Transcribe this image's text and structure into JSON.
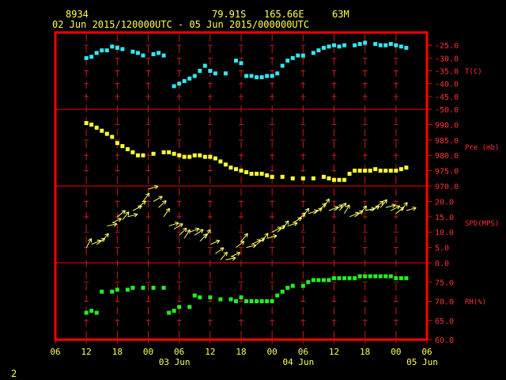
{
  "header": {
    "station_id": "8934",
    "latitude": "79.91S",
    "longitude": "165.66E",
    "elevation": "63M",
    "time_range": "02 Jun 2015/120000UTC - 05 Jun 2015/000000UTC"
  },
  "footer": {
    "page_number": "2"
  },
  "colors": {
    "frame": "#ff0000",
    "grid": "#c81a1a",
    "axis_text": "#ff3030",
    "header_text": "#ffff4f",
    "temperature": "#33e6f0",
    "pressure": "#ffff33",
    "wind": "#ffff66",
    "humidity": "#22ee22"
  },
  "chart_data": {
    "type": "scatter",
    "x_unit": "hours since 02 Jun 2015 12:00 UTC (3-hour ticks)",
    "x": {
      "range": [
        -6,
        66
      ],
      "tick_labels": [
        "06",
        "12",
        "18",
        "00",
        "06",
        "12",
        "18",
        "00",
        "06",
        "12",
        "18",
        "00",
        "06"
      ],
      "day_labels": [
        "03 Jun",
        "04 Jun",
        "05 Jun"
      ]
    },
    "panels": [
      {
        "name": "temperature",
        "label": "T(C)",
        "ylim": [
          -50,
          -20
        ],
        "ticks": [
          -25,
          -30,
          -35,
          -40,
          -45,
          -50
        ],
        "tick_labels": [
          "-25.0",
          "-30.0",
          "-35.0",
          "-40.0",
          "-45.0",
          "-50.0"
        ],
        "points": [
          [
            0,
            -30
          ],
          [
            1,
            -29.5
          ],
          [
            2,
            -28
          ],
          [
            3,
            -27
          ],
          [
            4,
            -27
          ],
          [
            5,
            -25.5
          ],
          [
            6,
            -26
          ],
          [
            7,
            -26.5
          ],
          [
            9,
            -27.5
          ],
          [
            10,
            -28
          ],
          [
            11,
            -29
          ],
          [
            13,
            -28.5
          ],
          [
            14,
            -28
          ],
          [
            15,
            -29
          ],
          [
            17,
            -41
          ],
          [
            18,
            -40
          ],
          [
            19,
            -39
          ],
          [
            20,
            -38
          ],
          [
            21,
            -37
          ],
          [
            22,
            -35
          ],
          [
            23,
            -33
          ],
          [
            24,
            -35
          ],
          [
            25,
            -36
          ],
          [
            27,
            -36
          ],
          [
            29,
            -31
          ],
          [
            30,
            -32
          ],
          [
            31,
            -37
          ],
          [
            32,
            -37
          ],
          [
            33,
            -37.5
          ],
          [
            34,
            -37.5
          ],
          [
            35,
            -37
          ],
          [
            36,
            -37
          ],
          [
            37,
            -36
          ],
          [
            38,
            -33
          ],
          [
            39,
            -31
          ],
          [
            40,
            -30
          ],
          [
            41,
            -29
          ],
          [
            42,
            -29
          ],
          [
            44,
            -28
          ],
          [
            45,
            -27
          ],
          [
            46,
            -26
          ],
          [
            47,
            -25.5
          ],
          [
            48,
            -25
          ],
          [
            49,
            -25.5
          ],
          [
            50,
            -25
          ],
          [
            52,
            -25
          ],
          [
            53,
            -24.5
          ],
          [
            54,
            -24
          ],
          [
            56,
            -24.5
          ],
          [
            57,
            -25
          ],
          [
            58,
            -25
          ],
          [
            59,
            -24.5
          ],
          [
            60,
            -25
          ],
          [
            61,
            -25.5
          ],
          [
            62,
            -26
          ]
        ]
      },
      {
        "name": "pressure",
        "label": "Pre (mb)",
        "ylim": [
          970,
          995
        ],
        "ticks": [
          990,
          985,
          980,
          975,
          970
        ],
        "tick_labels": [
          "990.0",
          "985.0",
          "980.0",
          "975.0",
          "970.0"
        ],
        "points": [
          [
            0,
            990.5
          ],
          [
            1,
            990
          ],
          [
            2,
            989
          ],
          [
            3,
            988
          ],
          [
            4,
            987
          ],
          [
            5,
            986
          ],
          [
            6,
            984
          ],
          [
            7,
            983
          ],
          [
            8,
            982
          ],
          [
            9,
            981
          ],
          [
            10,
            980
          ],
          [
            11,
            980
          ],
          [
            13,
            980.5
          ],
          [
            15,
            981
          ],
          [
            16,
            981
          ],
          [
            17,
            980.5
          ],
          [
            18,
            980
          ],
          [
            19,
            979.5
          ],
          [
            20,
            979.5
          ],
          [
            21,
            980
          ],
          [
            22,
            980
          ],
          [
            23,
            979.5
          ],
          [
            24,
            979.5
          ],
          [
            25,
            979
          ],
          [
            26,
            978
          ],
          [
            27,
            977
          ],
          [
            28,
            976
          ],
          [
            29,
            975.5
          ],
          [
            30,
            975
          ],
          [
            31,
            974.5
          ],
          [
            32,
            974
          ],
          [
            33,
            974
          ],
          [
            34,
            974
          ],
          [
            35,
            973.5
          ],
          [
            36,
            973
          ],
          [
            38,
            973
          ],
          [
            40,
            972.5
          ],
          [
            42,
            972.5
          ],
          [
            44,
            972.5
          ],
          [
            46,
            973
          ],
          [
            47,
            972.5
          ],
          [
            48,
            972
          ],
          [
            49,
            972
          ],
          [
            50,
            972
          ],
          [
            51,
            974
          ],
          [
            52,
            975
          ],
          [
            53,
            975
          ],
          [
            54,
            975
          ],
          [
            55,
            975
          ],
          [
            56,
            975.5
          ],
          [
            57,
            975
          ],
          [
            58,
            975
          ],
          [
            59,
            975
          ],
          [
            60,
            975
          ],
          [
            61,
            975.5
          ],
          [
            62,
            976
          ]
        ]
      },
      {
        "name": "wind_speed",
        "label": "SPD(MPS)",
        "ylim": [
          0,
          25
        ],
        "ticks": [
          20,
          15,
          10,
          5,
          0
        ],
        "tick_labels": [
          "20.0",
          "15.0",
          "10.0",
          "5.0",
          "0.0"
        ],
        "points": [
          [
            0,
            5
          ],
          [
            1,
            6
          ],
          [
            2,
            6
          ],
          [
            3,
            7
          ],
          [
            4,
            12
          ],
          [
            5,
            13
          ],
          [
            6,
            15
          ],
          [
            7,
            14
          ],
          [
            8,
            15
          ],
          [
            9,
            17
          ],
          [
            10,
            18
          ],
          [
            11,
            20
          ],
          [
            12,
            24
          ],
          [
            13,
            20
          ],
          [
            14,
            18
          ],
          [
            15,
            15
          ],
          [
            16,
            12
          ],
          [
            17,
            11
          ],
          [
            18,
            9
          ],
          [
            19,
            8
          ],
          [
            20,
            10
          ],
          [
            21,
            9
          ],
          [
            22,
            7
          ],
          [
            23,
            8
          ],
          [
            24,
            6
          ],
          [
            25,
            3
          ],
          [
            26,
            1
          ],
          [
            27,
            1
          ],
          [
            28,
            2
          ],
          [
            29,
            5
          ],
          [
            30,
            7
          ],
          [
            31,
            5
          ],
          [
            32,
            6
          ],
          [
            33,
            6
          ],
          [
            34,
            7
          ],
          [
            35,
            8
          ],
          [
            36,
            10
          ],
          [
            37,
            10
          ],
          [
            38,
            11
          ],
          [
            39,
            12
          ],
          [
            40,
            13
          ],
          [
            41,
            14
          ],
          [
            42,
            15
          ],
          [
            43,
            16
          ],
          [
            44,
            16
          ],
          [
            45,
            17
          ],
          [
            46,
            18
          ],
          [
            47,
            17
          ],
          [
            48,
            17
          ],
          [
            49,
            17
          ],
          [
            50,
            16
          ],
          [
            51,
            15
          ],
          [
            52,
            15
          ],
          [
            53,
            16
          ],
          [
            54,
            17
          ],
          [
            55,
            17
          ],
          [
            56,
            18
          ],
          [
            57,
            18
          ],
          [
            58,
            18
          ],
          [
            59,
            17
          ],
          [
            60,
            16
          ],
          [
            61,
            17
          ],
          [
            62,
            17
          ]
        ]
      },
      {
        "name": "relative_humidity",
        "label": "RH(%)",
        "ylim": [
          60,
          80
        ],
        "ticks": [
          75,
          70,
          65,
          60
        ],
        "tick_labels": [
          "75.0",
          "70.0",
          "65.0",
          "60.0"
        ],
        "points": [
          [
            0,
            67
          ],
          [
            1,
            67.5
          ],
          [
            2,
            67
          ],
          [
            3,
            72.5
          ],
          [
            5,
            72.5
          ],
          [
            6,
            73
          ],
          [
            8,
            73
          ],
          [
            9,
            73.5
          ],
          [
            11,
            73.5
          ],
          [
            13,
            73.5
          ],
          [
            15,
            73.5
          ],
          [
            16,
            67
          ],
          [
            17,
            67.5
          ],
          [
            18,
            68.5
          ],
          [
            20,
            68.5
          ],
          [
            21,
            71.5
          ],
          [
            22,
            71
          ],
          [
            24,
            71
          ],
          [
            26,
            70.5
          ],
          [
            28,
            70.5
          ],
          [
            29,
            70
          ],
          [
            30,
            71
          ],
          [
            31,
            70
          ],
          [
            32,
            70
          ],
          [
            33,
            70
          ],
          [
            34,
            70
          ],
          [
            35,
            70
          ],
          [
            36,
            70
          ],
          [
            37,
            71.5
          ],
          [
            38,
            72.5
          ],
          [
            39,
            73.5
          ],
          [
            40,
            74
          ],
          [
            42,
            74
          ],
          [
            43,
            75
          ],
          [
            44,
            75.5
          ],
          [
            45,
            75.5
          ],
          [
            46,
            75.5
          ],
          [
            47,
            75.5
          ],
          [
            48,
            76
          ],
          [
            49,
            76
          ],
          [
            50,
            76
          ],
          [
            51,
            76
          ],
          [
            52,
            76
          ],
          [
            53,
            76.5
          ],
          [
            54,
            76.5
          ],
          [
            55,
            76.5
          ],
          [
            56,
            76.5
          ],
          [
            57,
            76.5
          ],
          [
            58,
            76.5
          ],
          [
            59,
            76.5
          ],
          [
            60,
            76
          ],
          [
            61,
            76
          ],
          [
            62,
            76
          ]
        ]
      }
    ]
  }
}
